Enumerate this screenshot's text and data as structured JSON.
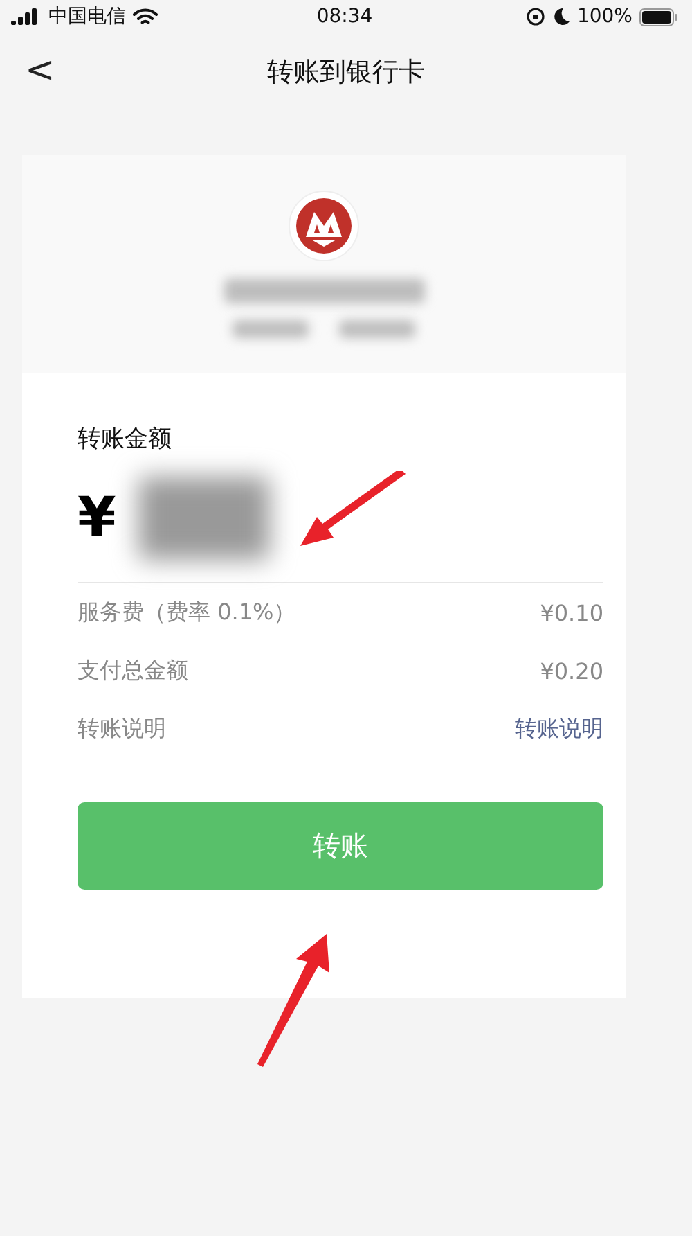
{
  "status_bar": {
    "carrier": "中国电信",
    "time": "08:34",
    "battery": "100%"
  },
  "nav": {
    "back": "<",
    "title": "转账到银行卡"
  },
  "amount": {
    "label": "转账金额",
    "currency": "¥"
  },
  "details": [
    {
      "kind": "plain",
      "label": "服务费（费率 0.1%）",
      "value": "¥0.10"
    },
    {
      "kind": "plain",
      "label": "支付总金额",
      "value": "¥0.20"
    },
    {
      "kind": "link",
      "label": "转账说明",
      "value": "转账说明"
    }
  ],
  "submit": {
    "label": "转账"
  }
}
